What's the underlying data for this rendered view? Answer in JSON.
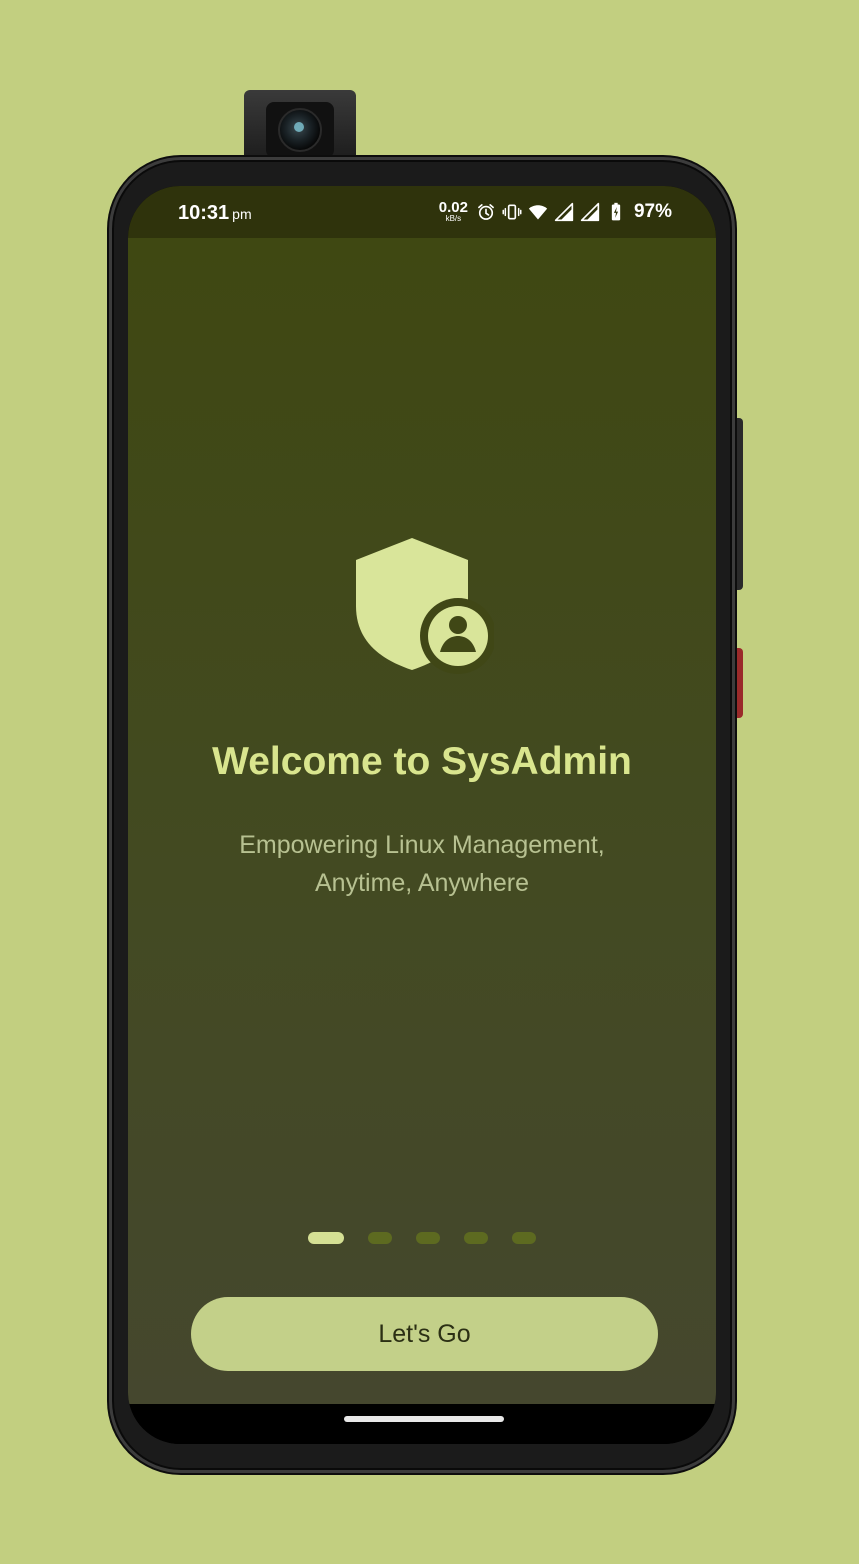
{
  "status_bar": {
    "time": "10:31",
    "ampm": "pm",
    "net_speed_value": "0.02",
    "net_speed_unit": "kB/s",
    "battery_percent": "97%",
    "icons": [
      "alarm-icon",
      "vibrate-icon",
      "wifi-icon",
      "signal-icon",
      "signal-icon",
      "battery-charging-icon"
    ]
  },
  "hero": {
    "icon": "shield-user-icon",
    "title": "Welcome to SysAdmin",
    "subtitle_line1": "Empowering Linux Management,",
    "subtitle_line2": "Anytime, Anywhere"
  },
  "pager": {
    "total": 5,
    "active_index": 0
  },
  "cta": {
    "label": "Let's Go"
  },
  "colors": {
    "page_background": "#c2cf80",
    "app_background_top": "#3f4812",
    "app_background_bottom": "#45472e",
    "accent": "#d9e58e",
    "button": "#c3d089"
  }
}
